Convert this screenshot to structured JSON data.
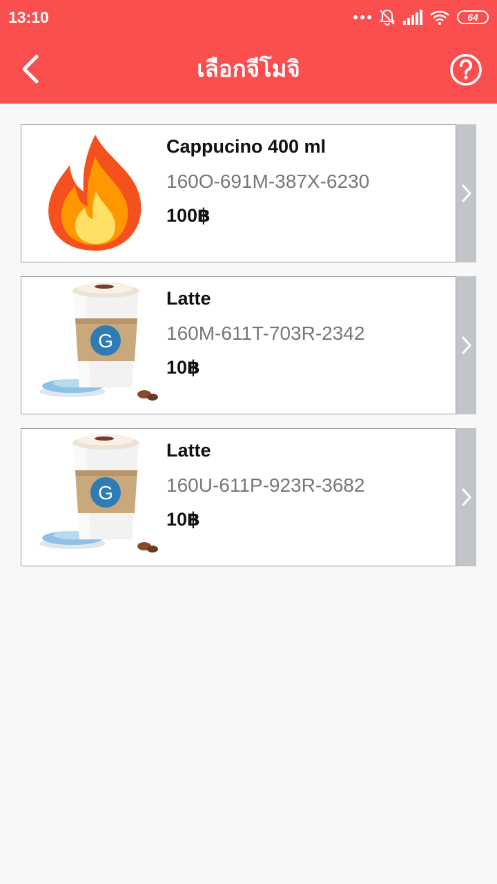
{
  "status_bar": {
    "time": "13:10",
    "battery": "64",
    "icons": [
      "more-dots-icon",
      "bell-off-icon",
      "signal-icon",
      "wifi-icon",
      "battery-icon"
    ]
  },
  "header": {
    "title": "เลือกจีโมจิ",
    "back_icon": "chevron-left-icon",
    "help_icon": "question-circle-icon",
    "background_color": "#fb4e4e"
  },
  "items": [
    {
      "name": "Cappucino 400 ml",
      "code": "160O-691M-387X-6230",
      "price": "100฿",
      "image": "fire-emoji"
    },
    {
      "name": "Latte",
      "code": "160M-611T-703R-2342",
      "price": "10฿",
      "image": "coffee-cup"
    },
    {
      "name": "Latte",
      "code": "160U-611P-923R-3682",
      "price": "10฿",
      "image": "coffee-cup"
    }
  ]
}
